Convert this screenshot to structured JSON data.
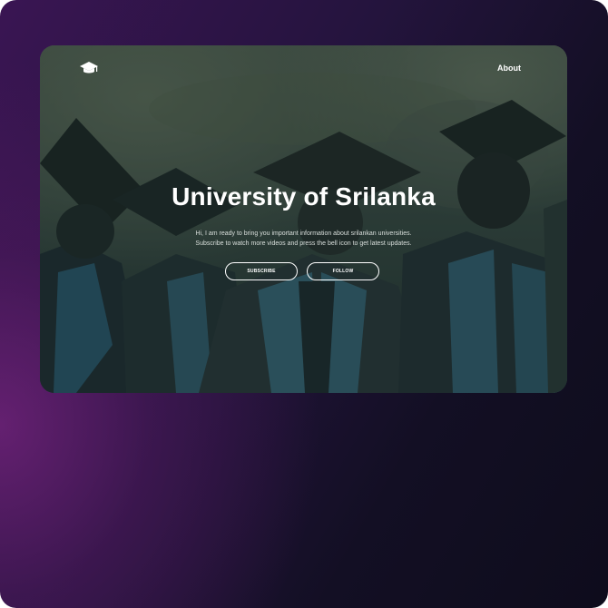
{
  "header": {
    "logo_icon": "graduation-cap-icon",
    "nav_about": "About"
  },
  "hero": {
    "title": "University of Srilanka",
    "text_line1": "Hi, I am ready to bring you important information about srilankan universities.",
    "text_line2": "Subscribe to watch more videos and press the bell icon to get latest updates.",
    "subscribe_label": "SUBSCRIBE",
    "follow_label": "FOLLOW",
    "background_image": "graduates-in-caps-and-gowns"
  },
  "colors": {
    "background_purple": "#3a1553",
    "background_dark": "#0e0c1c",
    "card_tint": "#2f3e38",
    "text": "#ffffff"
  }
}
